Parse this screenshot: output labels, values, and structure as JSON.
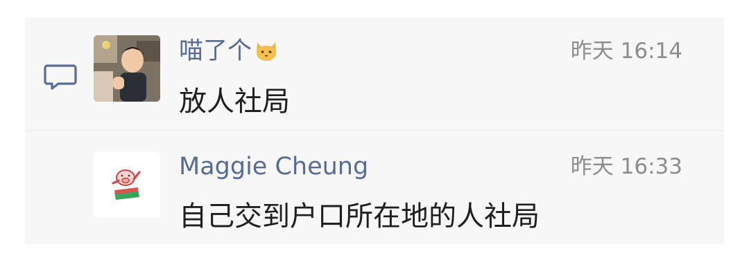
{
  "comments": [
    {
      "author": "喵了个",
      "author_emoji": "cat-face-icon",
      "time": "昨天 16:14",
      "text": "放人社局"
    },
    {
      "author": "Maggie Cheung",
      "time": "昨天 16:33",
      "text": "自己交到户口所在地的人社局"
    }
  ],
  "colors": {
    "name": "#576b95",
    "time": "#8c8c8c",
    "text": "#1f1f1f",
    "panel": "#f7f7f7"
  }
}
